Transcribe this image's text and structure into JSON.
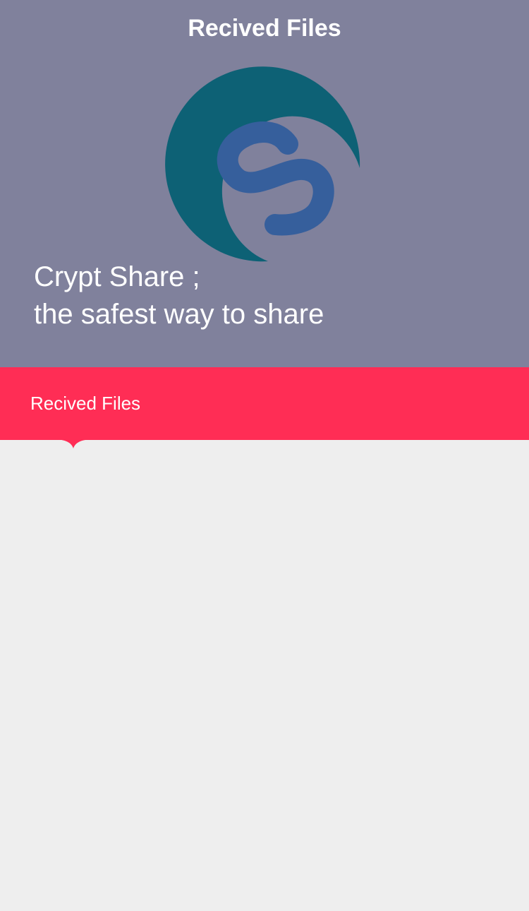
{
  "header": {
    "title": "Recived Files"
  },
  "hero": {
    "logo_icon": "crypt-share-logo-icon",
    "tagline_line1": "Crypt Share ;",
    "tagline_line2": "the safest way to share"
  },
  "tabs": [
    {
      "label": "Recived Files",
      "selected": true
    }
  ],
  "colors": {
    "hero_background": "#80819c",
    "tab_bar": "#ff2d55",
    "logo_ring": "#0d6175",
    "logo_s": "#365f9c",
    "content_background": "#eeeeee"
  }
}
